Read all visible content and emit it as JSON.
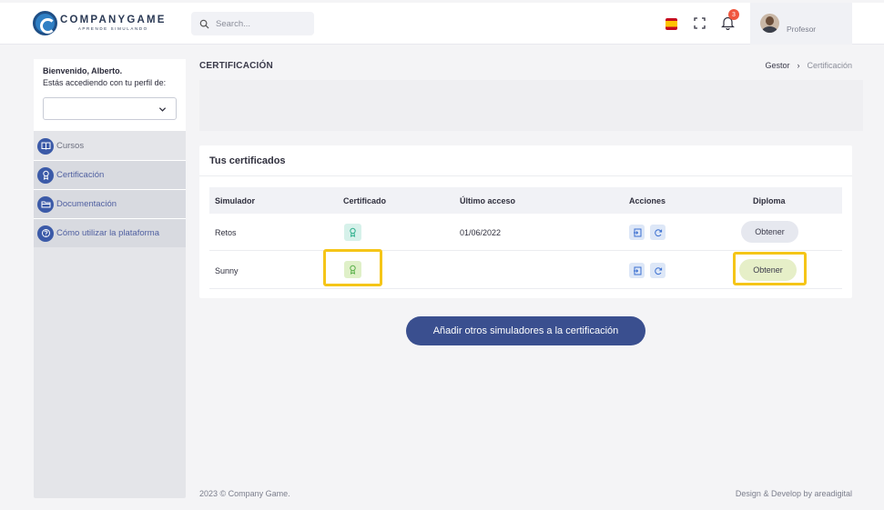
{
  "header": {
    "logo_main": "COMPANYGAME",
    "logo_sub": "APRENDE SIMULANDO",
    "search_placeholder": "Search...",
    "notification_count": "3",
    "user_role": "Profesor",
    "icons": [
      "search-icon",
      "spain-flag-icon",
      "fullscreen-icon",
      "bell-icon"
    ]
  },
  "sidebar": {
    "greeting": "Bienvenido, Alberto.",
    "profile_prompt": "Estás accediendo con tu perfil de:",
    "profile_value": "",
    "items": [
      {
        "label": "Cursos",
        "icon": "book-icon",
        "active": false
      },
      {
        "label": "Certificación",
        "icon": "award-icon",
        "active": true
      },
      {
        "label": "Documentación",
        "icon": "folder-icon",
        "active": true
      },
      {
        "label": "Cómo utilizar la plataforma",
        "icon": "help-icon",
        "active": true
      }
    ]
  },
  "page": {
    "title": "CERTIFICACIÓN",
    "breadcrumb": [
      "Gestor",
      "Certificación"
    ]
  },
  "certificates": {
    "title": "Tus certificados",
    "columns": [
      "Simulador",
      "Certificado",
      "Último acceso",
      "Acciones",
      "Diploma"
    ],
    "rows": [
      {
        "simulador": "Retos",
        "ultimo_acceso": "01/06/2022",
        "diploma_label": "Obtener",
        "highlighted": false
      },
      {
        "simulador": "Sunny",
        "ultimo_acceso": "",
        "diploma_label": "Obtener",
        "highlighted": true
      }
    ]
  },
  "cta_label": "Añadir otros simuladores a la certificación",
  "footer": {
    "copyright": "2023 © Company Game.",
    "credit": "Design & Develop by areadigital"
  },
  "colors": {
    "primary": "#3a4f8f",
    "highlight": "#f5c518",
    "badge": "#f0573f"
  }
}
